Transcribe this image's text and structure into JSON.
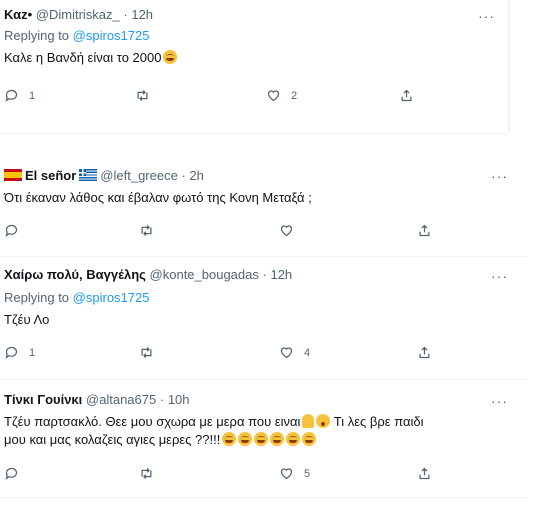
{
  "tweets": [
    {
      "name": "Καz•",
      "handle": "@Dimitriskaz_",
      "dot": "·",
      "time": "12h",
      "replying_prefix": "Replying to",
      "replying_mention": "@spiros1725",
      "text": "Καλε η Βανδή είναι το 2000",
      "more": "···",
      "replies": "1",
      "likes": "2"
    },
    {
      "name": "El señor",
      "handle": "@left_greece",
      "dot": "·",
      "time": "2h",
      "text": "Ότι έκαναν λάθος και έβαλαν φωτό της Κονη Μεταξά ;",
      "more": "···"
    },
    {
      "name": "Χαίρω πολύ, Βαγγέλης",
      "handle": "@konte_bougadas",
      "dot": "·",
      "time": "12h",
      "replying_prefix": "Replying to",
      "replying_mention": "@spiros1725",
      "text": "Τζέυ Λο",
      "more": "···",
      "replies": "1",
      "likes": "4"
    },
    {
      "name": "Τίνκι Γουίνκι",
      "handle": "@altana675",
      "dot": "·",
      "time": "10h",
      "text_line1": "Τζέυ παρτσακλό. Θεε μου σχωρα με μερα που ειναι",
      "text_line1_tail": " Τι λες βρε παιδι",
      "text_line2": "μου και μας κολαζεις αγιες μερες ??!!!",
      "more": "···",
      "likes": "5"
    }
  ],
  "icons": {
    "reply": "reply-icon",
    "retweet": "retweet-icon",
    "like": "heart-icon",
    "share": "share-icon",
    "more": "more-icon"
  },
  "colors": {
    "text": "#0f1419",
    "secondary": "#536471",
    "link": "#1d9bf0",
    "divider": "#eff3f4"
  }
}
